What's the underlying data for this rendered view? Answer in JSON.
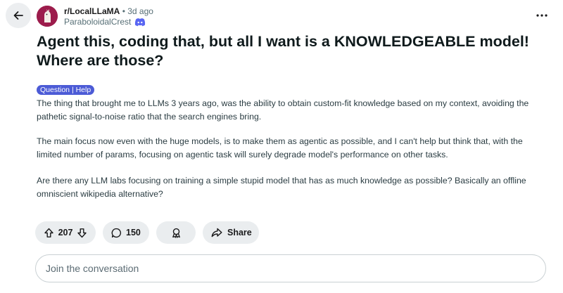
{
  "header": {
    "subreddit": "r/LocalLLaMA",
    "separator": "•",
    "time": "3d ago",
    "author": "ParaboloidalCrest"
  },
  "post": {
    "title": "Agent this, coding that, but all I want is a KNOWLEDGEABLE model! Where are those?",
    "flair": "Question | Help",
    "flair_color": "#4c5bd6",
    "paragraphs": [
      "The thing that brought me to LLMs 3 years ago, was the ability to obtain custom-fit knowledge based on my context, avoiding the pathetic signal-to-noise ratio that the search engines bring.",
      "The main focus now even with the huge models, is to make them as agentic as possible, and I can't help but think that, with the limited number of params, focusing on agentic task will surely degrade model's performance on other tasks.",
      "Are there any LLM labs focusing on training a simple stupid model that has as much knowledge as possible? Basically an offline omniscient wikipedia alternative?"
    ]
  },
  "actions": {
    "upvote_count": "207",
    "comment_count": "150",
    "share_label": "Share"
  },
  "comment": {
    "placeholder": "Join the conversation"
  },
  "icons": {
    "back": "arrow-left-icon",
    "more": "more-horizontal-icon",
    "upvote": "arrow-up-icon",
    "downvote": "arrow-down-icon",
    "comment": "speech-bubble-icon",
    "award": "award-icon",
    "share": "share-arrow-icon",
    "badge": "discord-icon"
  },
  "colors": {
    "pill_background": "#eaedef",
    "avatar": "#9c1c4c",
    "discord": "#5865f2"
  }
}
